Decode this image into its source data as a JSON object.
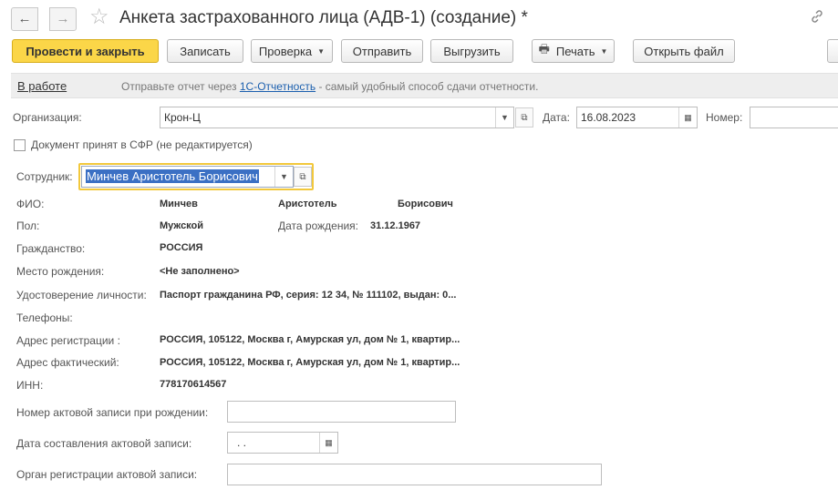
{
  "window": {
    "title": "Анкета застрахованного лица (АДВ-1) (создание) *",
    "back_glyph": "←",
    "forward_glyph": "→",
    "favorite_icon": "☆",
    "link_icon": "🔗"
  },
  "toolbar": {
    "post_close": "Провести и закрыть",
    "save": "Записать",
    "check": "Проверка",
    "send": "Отправить",
    "export": "Выгрузить",
    "print": "Печать",
    "open_file": "Открыть файл"
  },
  "infobar": {
    "status": "В работе",
    "message_prefix": "Отправьте отчет через",
    "message_link": "1С-Отчетность",
    "message_suffix": "- самый удобный способ сдачи отчетности."
  },
  "header_fields": {
    "organization_label": "Организация:",
    "organization_value": "Крон-Ц",
    "date_label": "Дата:",
    "date_value": "16.08.2023",
    "number_label": "Номер:",
    "number_value": ""
  },
  "checkbox": {
    "label": "Документ принят в СФР (не редактируется)",
    "checked": false
  },
  "employee": {
    "label": "Сотрудник:",
    "value": "Минчев Аристотель Борисович"
  },
  "details": {
    "fio_label": "ФИО:",
    "last_name": "Минчев",
    "first_name": "Аристотель",
    "patronymic": "Борисович",
    "gender_label": "Пол:",
    "gender": "Мужской",
    "birthdate_label": "Дата рождения:",
    "birthdate": "31.12.1967",
    "citizenship_label": "Гражданство:",
    "citizenship": "РОССИЯ",
    "birthplace_label": "Место рождения:",
    "birthplace": "<Не заполнено>",
    "id_doc_label": "Удостоверение личности:",
    "id_doc": "Паспорт гражданина РФ, серия: 12 34, № 111102, выдан: 0...",
    "phones_label": "Телефоны:",
    "phones": "",
    "reg_address_label": "Адрес регистрации :",
    "reg_address": "РОССИЯ, 105122, Москва г, Амурская ул, дом № 1, квартир...",
    "actual_address_label": "Адрес фактический:",
    "actual_address": "РОССИЯ, 105122, Москва г, Амурская ул, дом № 1, квартир...",
    "inn_label": "ИНН:",
    "inn": "778170614567"
  },
  "birth_record": {
    "number_label": "Номер актовой записи при рождении:",
    "number_value": "",
    "date_label": "Дата составления актовой записи:",
    "date_value": " .  .",
    "authority_label": "Орган регистрации актовой записи:",
    "authority_value": ""
  },
  "colors": {
    "primary_button": "#fbd648",
    "focus_border": "#f2c83b",
    "link": "#1b5fae",
    "selection": "#3b70c4"
  }
}
